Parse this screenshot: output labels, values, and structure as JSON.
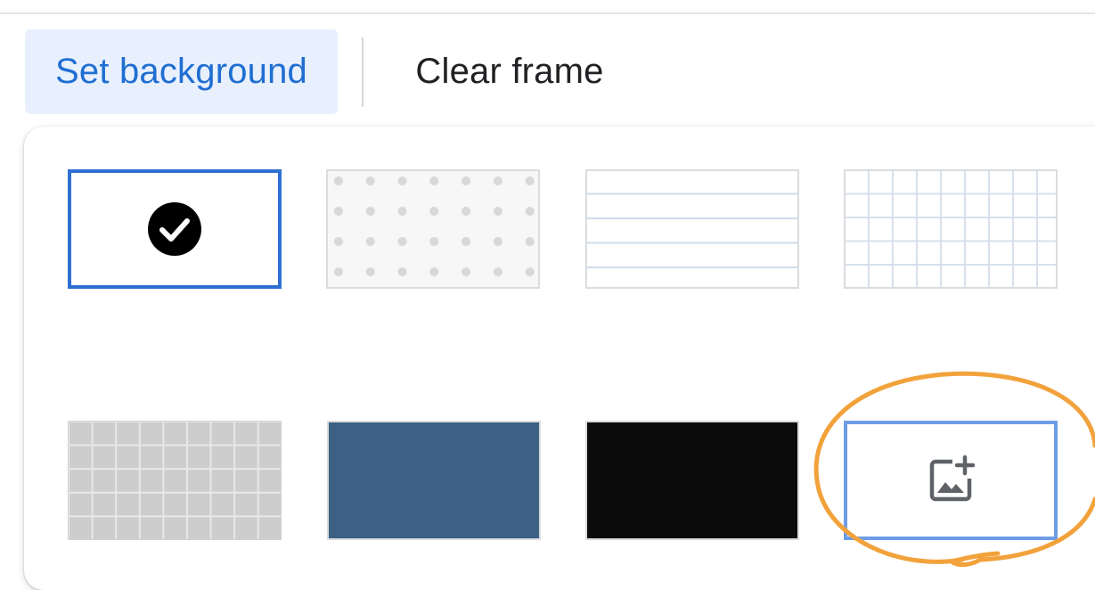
{
  "toolbar": {
    "set_background_label": "Set background",
    "clear_frame_label": "Clear frame"
  },
  "backgrounds": [
    {
      "name": "blank",
      "selected": true,
      "icon": "check-circle-icon"
    },
    {
      "name": "dots",
      "selected": false
    },
    {
      "name": "lines",
      "selected": false
    },
    {
      "name": "grid",
      "selected": false
    },
    {
      "name": "gray-grid",
      "selected": false
    },
    {
      "name": "blue",
      "selected": false,
      "color": "#3c6184"
    },
    {
      "name": "black",
      "selected": false,
      "color": "#0b0b0b"
    },
    {
      "name": "add-image",
      "selected": false,
      "icon": "add-image-icon"
    }
  ],
  "colors": {
    "accent": "#1f6ed2",
    "annotation": "#f2a23b"
  }
}
